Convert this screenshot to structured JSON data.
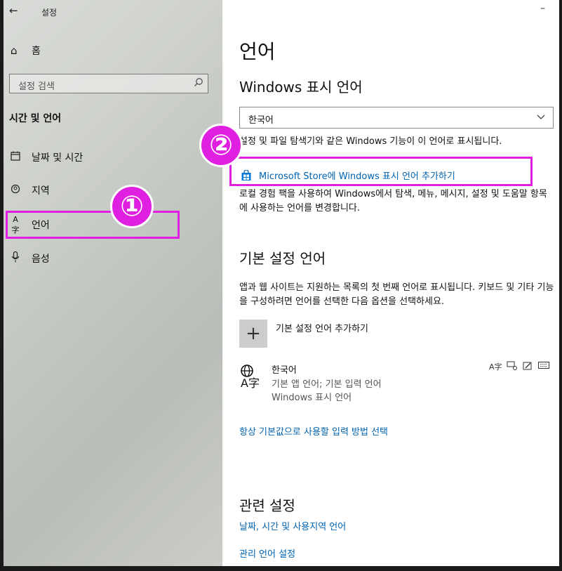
{
  "window": {
    "title": "설정",
    "minimize_label": "–"
  },
  "sidebar": {
    "home_label": "홈",
    "search_placeholder": "설정 검색",
    "section_title": "시간 및 언어",
    "items": [
      {
        "label": "날짜 및 시간",
        "icon": "calendar-icon"
      },
      {
        "label": "지역",
        "icon": "globe-region-icon"
      },
      {
        "label": "언어",
        "icon": "language-icon",
        "selected": true
      },
      {
        "label": "음성",
        "icon": "microphone-icon"
      }
    ]
  },
  "main": {
    "title": "언어",
    "display_lang_heading": "Windows 표시 언어",
    "display_lang_value": "한국어",
    "display_lang_desc": "설정 및 파일 탐색기와 같은 Windows 기능이 이 언어로 표시됩니다.",
    "store_link": "Microsoft Store에 Windows 표시 언어 추가하기",
    "store_desc": "로컬 경험 팩을 사용하여 Windows에서 탐색, 메뉴, 메시지, 설정 및 도움말 항목에 사용하는 언어를 변경합니다.",
    "preferred_heading": "기본 설정 언어",
    "preferred_desc": "앱과 웹 사이트는 지원하는 목록의 첫 번째 언어로 표시됩니다. 키보드 및 기타 기능을 구성하려면 언어를 선택한 다음 옵션을 선택하세요.",
    "add_lang_label": "기본 설정 언어 추가하기",
    "add_icon_glyph": "+",
    "language": {
      "name": "한국어",
      "sub1": "기본 앱 언어; 기본 입력 언어",
      "sub2": "Windows 표시 언어"
    },
    "input_method_link": "항상 기본값으로 사용할 입력 방법 선택",
    "related_heading": "관련 설정",
    "related_links": [
      "날짜, 시간 및 사용지역 언어",
      "관리 언어 설정"
    ]
  },
  "annotations": {
    "badge1": "①",
    "badge2": "②",
    "color": "#e020e0"
  }
}
